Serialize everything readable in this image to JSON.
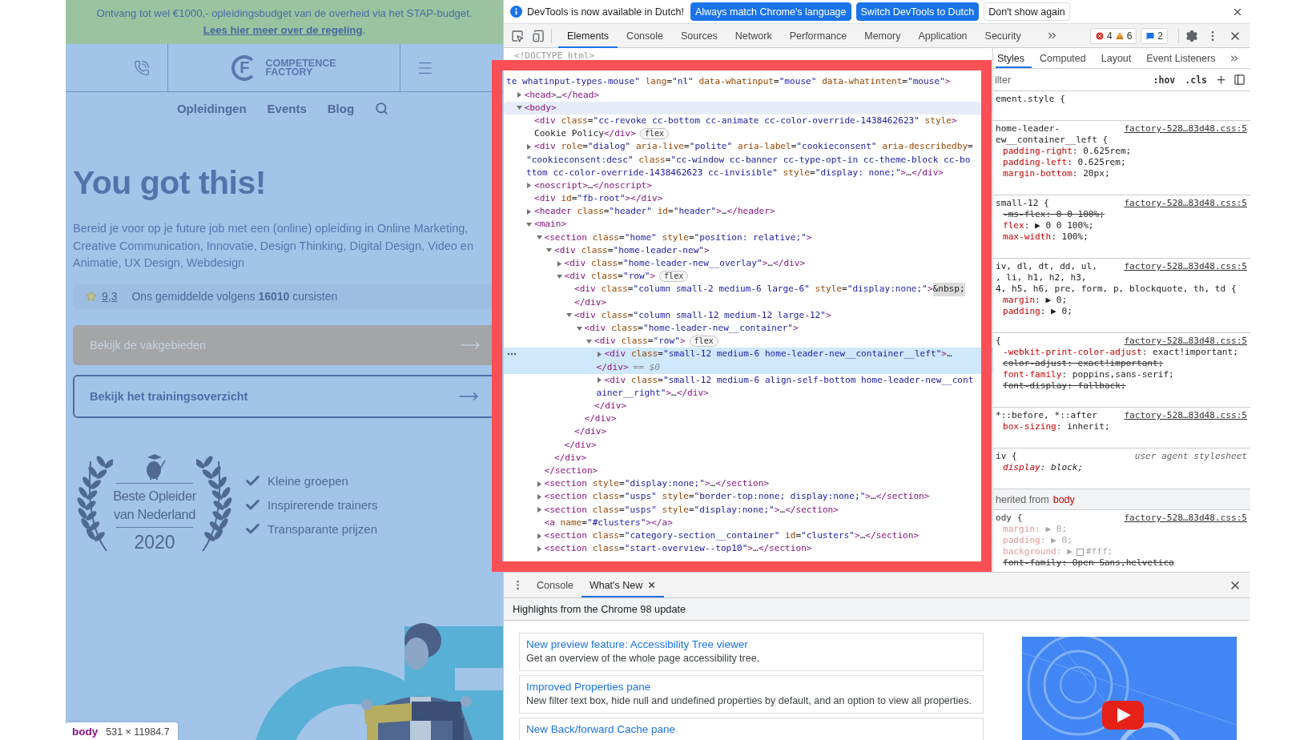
{
  "banner": {
    "text": "Ontvang tot wel €1000,- opleidingsbudget van de overheid via het STAP-budget.",
    "link": "Lees hier meer over de regeling",
    "after_link": "."
  },
  "site_header": {
    "logo": {
      "mark": "F",
      "name_lines": [
        "COMPETENCE",
        "FACTORY"
      ]
    }
  },
  "nav": [
    {
      "label": "Opleidingen"
    },
    {
      "label": "Events"
    },
    {
      "label": "Blog"
    }
  ],
  "hero": {
    "title": "You got this!",
    "text": "Bereid je voor op je future job met een (online) opleiding in Online Marketing, Creative Communication, Innovatie, Design Thinking, Digital Design, Video en Animatie, UX Design, Webdesign",
    "rating": {
      "score": "9,3",
      "text": "Ons gemiddelde volgens **16010** cursisten"
    }
  },
  "buttons": [
    {
      "label": "Bekijk de vakgebieden",
      "kind": "filled"
    },
    {
      "label": "Bekijk het trainingsoverzicht",
      "kind": "outline"
    }
  ],
  "award": {
    "lines": [
      "Beste Opleider",
      "van Nederland"
    ],
    "year": "2020"
  },
  "usps": [
    "Kleine groepen",
    "Inspirerende trainers",
    "Transparante prijzen"
  ],
  "hero_image": {
    "kind": "picture"
  },
  "inspect_tooltip": {
    "tag": "body",
    "size": "531 × 11984.7"
  },
  "devtools": {
    "infobar": {
      "text": "DevTools is now available in Dutch!",
      "actions": [
        {
          "label": "Always match Chrome's language",
          "kind": "primary"
        },
        {
          "label": "Switch DevTools to Dutch",
          "kind": "primary"
        },
        {
          "label": "Don't show again",
          "kind": "secondary"
        }
      ]
    },
    "tabs": [
      {
        "label": "Elements",
        "selected": true
      },
      {
        "label": "Console",
        "selected": false
      },
      {
        "label": "Sources",
        "selected": false
      },
      {
        "label": "Network",
        "selected": false
      },
      {
        "label": "Performance",
        "selected": false
      },
      {
        "label": "Memory",
        "selected": false
      },
      {
        "label": "Application",
        "selected": false
      },
      {
        "label": "Security",
        "selected": false
      }
    ],
    "issues": [
      {
        "kind": "error",
        "count": "4"
      },
      {
        "kind": "warning",
        "count": "6"
      }
    ],
    "messages": "2",
    "elements": {
      "doctype": "<!DOCTYPE html>",
      "tree": [
        {
          "lines": [
            "te whatinput-types-mouse\" lang=\"nl\" data-whatinput=\"mouse\" data-whatintent=\"mouse\">"
          ],
          "continues": true,
          "selected": false,
          "hovered": false,
          "children": [
            {
              "lines": [
                "<head>…</head>"
              ],
              "expanded": false,
              "selected": false,
              "hovered": false
            },
            {
              "lines": [
                "<body>"
              ],
              "expanded": true,
              "selected": false,
              "hovered": true,
              "children": [
                {
                  "lines": [
                    "<div class=\"cc-revoke cc-bottom cc-animate cc-color-override-1438462623\" style>",
                    "Cookie Policy</div>"
                  ],
                  "badge": "flex",
                  "selected": false,
                  "hovered": false
                },
                {
                  "lines": [
                    "<div role=\"dialog\" aria-live=\"polite\" aria-label=\"cookieconsent\" aria-describedby=",
                    "\"cookieconsent:desc\" class=\"cc-window cc-banner cc-type-opt-in cc-theme-block cc-bo",
                    "ttom cc-color-override-1438462623 cc-invisible\" style=\"display: none;\">…</div>"
                  ],
                  "expanded": false,
                  "selected": false,
                  "hovered": false
                },
                {
                  "lines": [
                    "<noscript>…</noscript>"
                  ],
                  "expanded": false,
                  "selected": false,
                  "hovered": false
                },
                {
                  "lines": [
                    "<div id=\"fb-root\"></div>"
                  ],
                  "selected": false,
                  "hovered": false
                },
                {
                  "lines": [
                    "<header class=\"header\" id=\"header\">…</header>"
                  ],
                  "expanded": false,
                  "selected": false,
                  "hovered": false
                },
                {
                  "lines": [
                    "<main>"
                  ],
                  "expanded": true,
                  "selected": false,
                  "hovered": false,
                  "children": [
                    {
                      "lines": [
                        "<section class=\"home\" style=\"position: relative;\">"
                      ],
                      "expanded": true,
                      "selected": false,
                      "hovered": false,
                      "close": "</section>",
                      "children": [
                        {
                          "lines": [
                            "<div class=\"home-leader-new\">"
                          ],
                          "expanded": true,
                          "selected": false,
                          "hovered": false,
                          "close": "</div>",
                          "children": [
                            {
                              "lines": [
                                "<div class=\"home-leader-new__overlay\">…</div>"
                              ],
                              "expanded": false,
                              "selected": false,
                              "hovered": false
                            },
                            {
                              "lines": [
                                "<div class=\"row\">"
                              ],
                              "badge": "flex",
                              "expanded": true,
                              "selected": false,
                              "hovered": false,
                              "close": "</div>",
                              "children": [
                                {
                                  "lines": [
                                    "<div class=\"column small-2 medium-6 large-6\" style=\"display:none;\">&nbsp;",
                                    "</div>"
                                  ],
                                  "selected": false,
                                  "hovered": false
                                },
                                {
                                  "lines": [
                                    "<div class=\"column small-12 medium-12 large-12\">"
                                  ],
                                  "expanded": true,
                                  "selected": false,
                                  "hovered": false,
                                  "close": "</div>",
                                  "children": [
                                    {
                                      "lines": [
                                        "<div class=\"home-leader-new__container\">"
                                      ],
                                      "expanded": true,
                                      "selected": false,
                                      "hovered": false,
                                      "close": "</div>",
                                      "children": [
                                        {
                                          "lines": [
                                            "<div class=\"row\">"
                                          ],
                                          "badge": "flex",
                                          "expanded": true,
                                          "selected": false,
                                          "hovered": false,
                                          "close": "</div>",
                                          "children": [
                                            {
                                              "lines": [
                                                "<div class=\"small-12 medium-6 home-leader-new__container__left\">…",
                                                "</div>"
                                              ],
                                              "marker": "== $0",
                                              "expanded": false,
                                              "selected": true,
                                              "hovered": false
                                            },
                                            {
                                              "lines": [
                                                "<div class=\"small-12 medium-6 align-self-bottom home-leader-new__cont",
                                                "ainer__right\">…</div>"
                                              ],
                                              "expanded": false,
                                              "selected": false,
                                              "hovered": false
                                            }
                                          ]
                                        }
                                      ]
                                    }
                                  ]
                                }
                              ]
                            }
                          ]
                        }
                      ]
                    },
                    {
                      "lines": [
                        "<section style=\"display:none;\">…</section>"
                      ],
                      "expanded": false,
                      "selected": false,
                      "hovered": false
                    },
                    {
                      "lines": [
                        "<section class=\"usps\" style=\"border-top:none; display:none;\">…</section>"
                      ],
                      "expanded": false,
                      "selected": false,
                      "hovered": false
                    },
                    {
                      "lines": [
                        "<section class=\"usps\" style=\"display:none;\">…</section>"
                      ],
                      "expanded": false,
                      "selected": false,
                      "hovered": false
                    },
                    {
                      "lines": [
                        "<a name=\"#clusters\"></a>"
                      ],
                      "selected": false,
                      "hovered": false
                    },
                    {
                      "lines": [
                        "<section class=\"category-section__container\" id=\"clusters\">…</section>"
                      ],
                      "expanded": false,
                      "selected": false,
                      "hovered": false
                    },
                    {
                      "lines": [
                        "<section class=\"start-overview--top10\">…</section>"
                      ],
                      "expanded": false,
                      "selected": false,
                      "hovered": false
                    }
                  ]
                }
              ]
            }
          ]
        }
      ]
    },
    "styles": {
      "tabs": [
        {
          "label": "Styles",
          "selected": true
        },
        {
          "label": "Computed",
          "selected": false
        },
        {
          "label": "Layout",
          "selected": false
        },
        {
          "label": "Event Listeners",
          "selected": false
        }
      ],
      "filter": {
        "placeholder": "ilter"
      },
      "tools": [
        ":hov",
        ".cls"
      ],
      "rules": [
        {
          "kind": "rule",
          "selector": [
            "ement.style {"
          ],
          "dimmed": false
        },
        {
          "kind": "rule",
          "selector": [
            "home-leader-",
            "ew__container__left {"
          ],
          "source": "factory-528…83d48.css:5",
          "source_is_link": true,
          "dimmed": false,
          "props": [
            {
              "kind": "plain",
              "name": "padding-right",
              "rest": ": 0.625rem;",
              "struck": false
            },
            {
              "kind": "plain",
              "name": "padding-left",
              "rest": ": 0.625rem;",
              "struck": false
            },
            {
              "kind": "plain",
              "name": "margin-bottom",
              "rest": ": 20px;",
              "struck": false
            }
          ]
        },
        {
          "kind": "rule",
          "selector": [
            "small-12 {"
          ],
          "source": "factory-528…83d48.css:5",
          "source_is_link": true,
          "dimmed": false,
          "props": [
            {
              "kind": "plain",
              "name": "-ms-flex",
              "rest": ": 0 0 100%;",
              "struck": true
            },
            {
              "kind": "plain",
              "name": "flex",
              "rest": ": ▶ 0 0 100%;",
              "struck": false
            },
            {
              "kind": "plain",
              "name": "max-width",
              "rest": ": 100%;",
              "struck": false
            }
          ]
        },
        {
          "kind": "rule",
          "selector": [
            "iv, dl, dt, dd, ul,",
            ", li, h1, h2, h3,",
            "4, h5, h6, pre, form, p, blockquote, th, td {"
          ],
          "source": "factory-528…83d48.css:5",
          "source_is_link": true,
          "dimmed": false,
          "props": [
            {
              "kind": "plain",
              "name": "margin",
              "rest": ": ▶ 0;",
              "struck": false
            },
            {
              "kind": "plain",
              "name": "padding",
              "rest": ": ▶ 0;",
              "struck": false
            }
          ]
        },
        {
          "kind": "rule",
          "selector": [
            "{"
          ],
          "source": "factory-528…83d48.css:5",
          "source_is_link": true,
          "dimmed": false,
          "props": [
            {
              "kind": "plain",
              "name": "-webkit-print-color-adjust",
              "rest": ": exact!important;",
              "struck": false
            },
            {
              "kind": "plain",
              "name": "color-adjust",
              "rest": ": exact!important;",
              "struck": true
            },
            {
              "kind": "plain",
              "name": "font-family",
              "rest": ": poppins,sans-serif;",
              "struck": false
            },
            {
              "kind": "plain",
              "name": "font-display",
              "rest": ": fallback;",
              "struck": true
            }
          ]
        },
        {
          "kind": "rule",
          "selector": [
            "*::before, *::after"
          ],
          "source": "factory-528…83d48.css:5",
          "source_is_link": true,
          "dimmed": false,
          "props": [
            {
              "kind": "plain",
              "name": "box-sizing",
              "rest": ": inherit;",
              "struck": false
            }
          ]
        },
        {
          "kind": "rule",
          "selector": [
            "iv {"
          ],
          "source": "user agent stylesheet",
          "source_is_link": false,
          "dimmed": false,
          "props": [
            {
              "kind": "plain",
              "name": "display",
              "rest": ": block;",
              "struck": false
            }
          ]
        },
        {
          "kind": "inherited",
          "label": "herited from",
          "selector": "body"
        },
        {
          "kind": "rule",
          "selector": [
            "ody {"
          ],
          "source": "factory-528…83d48.css:5",
          "source_is_link": true,
          "dimmed": true,
          "props": [
            {
              "kind": "plain",
              "name": "margin",
              "rest": ": ▶ 0;",
              "struck": false
            },
            {
              "kind": "plain",
              "name": "padding",
              "rest": ": ▶ 0;",
              "struck": false
            },
            {
              "kind": "color",
              "name": "background",
              "rest": ": ▶",
              "after": "#fff;",
              "struck": false
            },
            {
              "kind": "plain",
              "name": "font-family",
              "rest": ": Open Sans,helvetica",
              "struck": true
            }
          ]
        }
      ]
    },
    "drawer": {
      "tabs": [
        {
          "label": "Console",
          "selected": false,
          "closable": false
        },
        {
          "label": "What's New",
          "selected": true,
          "closable": true
        }
      ],
      "heading": "Highlights from the Chrome 98 update",
      "items": [
        {
          "title": "New preview feature: Accessibility Tree viewer",
          "text": "Get an overview of the whole page accessibility tree."
        },
        {
          "title": "Improved Properties pane",
          "text": "New filter text box, hide null and undefined properties by default, and an option to view all properties."
        },
        {
          "title": "New Back/forward Cache pane"
        }
      ],
      "video": {
        "kind": "picture"
      }
    }
  }
}
